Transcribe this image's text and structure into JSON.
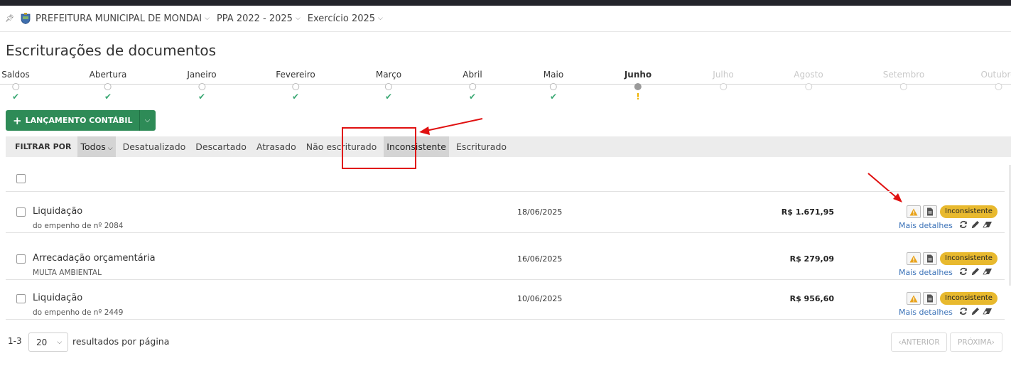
{
  "topbar": {
    "org": "PREFEITURA MUNICIPAL DE MONDAI",
    "ppa": "PPA 2022 - 2025",
    "exercicio": "Exercício 2025"
  },
  "page": {
    "title": "Escriturações de documentos"
  },
  "timeline": [
    {
      "label": "Saldos",
      "state": "done"
    },
    {
      "label": "Abertura",
      "state": "done"
    },
    {
      "label": "Janeiro",
      "state": "done"
    },
    {
      "label": "Fevereiro",
      "state": "done"
    },
    {
      "label": "Março",
      "state": "done"
    },
    {
      "label": "Abril",
      "state": "done"
    },
    {
      "label": "Maio",
      "state": "done"
    },
    {
      "label": "Junho",
      "state": "current"
    },
    {
      "label": "Julho",
      "state": "future"
    },
    {
      "label": "Agosto",
      "state": "future"
    },
    {
      "label": "Setembro",
      "state": "future"
    },
    {
      "label": "Outubro",
      "state": "future"
    }
  ],
  "actions": {
    "new_label": "LANÇAMENTO CONTÁBIL"
  },
  "filter": {
    "label": "FILTRAR POR",
    "options": [
      "Todos",
      "Desatualizado",
      "Descartado",
      "Atrasado",
      "Não escriturado",
      "Inconsistente",
      "Escriturado"
    ]
  },
  "rows": [
    {
      "title": "Liquidação",
      "subtitle": "do empenho de nº 2084",
      "date": "18/06/2025",
      "amount": "R$ 1.671,95",
      "status": "Inconsistente",
      "more": "Mais detalhes"
    },
    {
      "title": "Arrecadação orçamentária",
      "subtitle": "MULTA AMBIENTAL",
      "date": "16/06/2025",
      "amount": "R$ 279,09",
      "status": "Inconsistente",
      "more": "Mais detalhes"
    },
    {
      "title": "Liquidação",
      "subtitle": "do empenho de nº 2449",
      "date": "10/06/2025",
      "amount": "R$ 956,60",
      "status": "Inconsistente",
      "more": "Mais detalhes"
    }
  ],
  "pagination": {
    "range": "1-3",
    "page_size": "20",
    "per_page_label": "resultados por página",
    "prev_label": "ANTERIOR",
    "next_label": "PRÓXIMA"
  },
  "colors": {
    "accent": "#2e8b57",
    "badge": "#e8b92e",
    "check": "#3aa873",
    "warn": "#f0b400",
    "annotation": "#e01010"
  }
}
